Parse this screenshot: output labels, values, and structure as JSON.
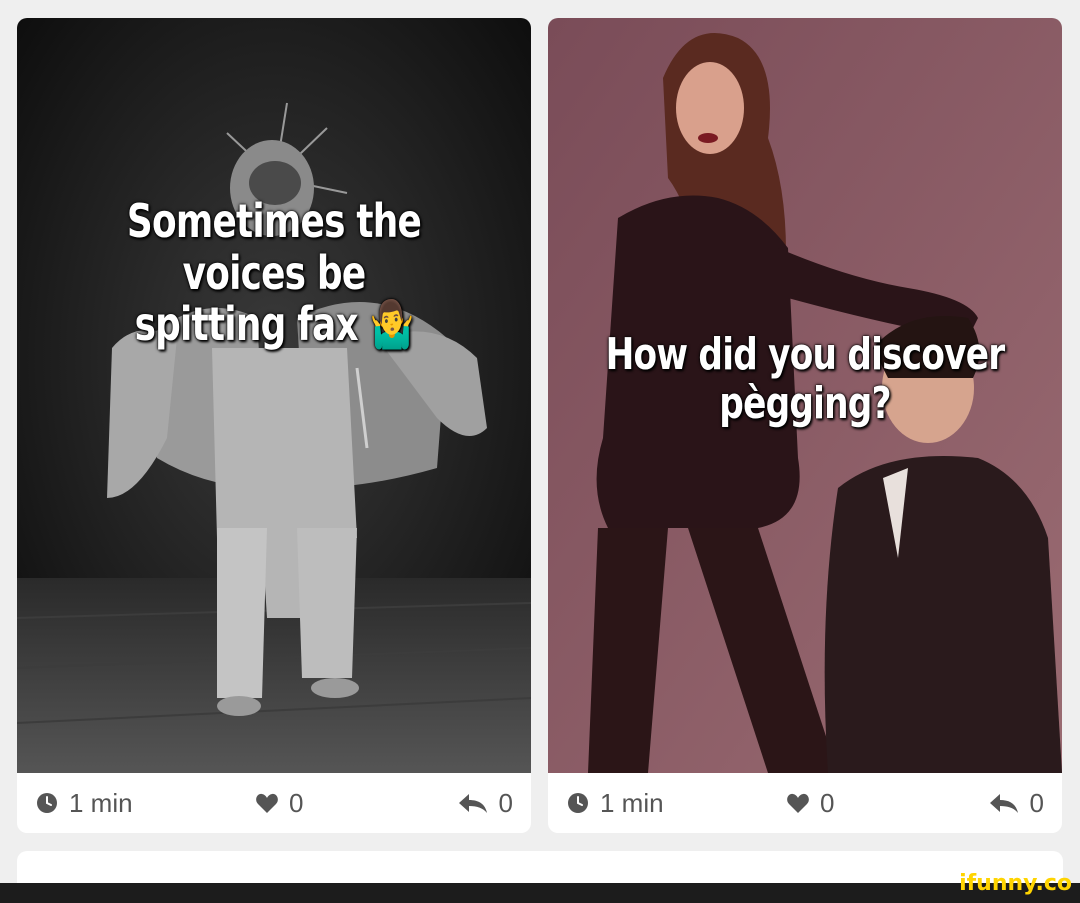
{
  "cards": [
    {
      "caption_line1": "Sometimes the voices be",
      "caption_line2": "spitting fax 🤷‍♂️",
      "time": "1 min",
      "likes": "0",
      "reposts": "0"
    },
    {
      "caption_line1": "How did you discover",
      "caption_line2": "pègging?",
      "time": "1 min",
      "likes": "0",
      "reposts": "0"
    }
  ],
  "watermark": "ifunny.co",
  "colors": {
    "page_bg": "#efefef",
    "card_bg": "#ffffff",
    "stat_text": "#555555",
    "watermark": "#ffd400",
    "footer_bar": "#1c1c1c"
  }
}
